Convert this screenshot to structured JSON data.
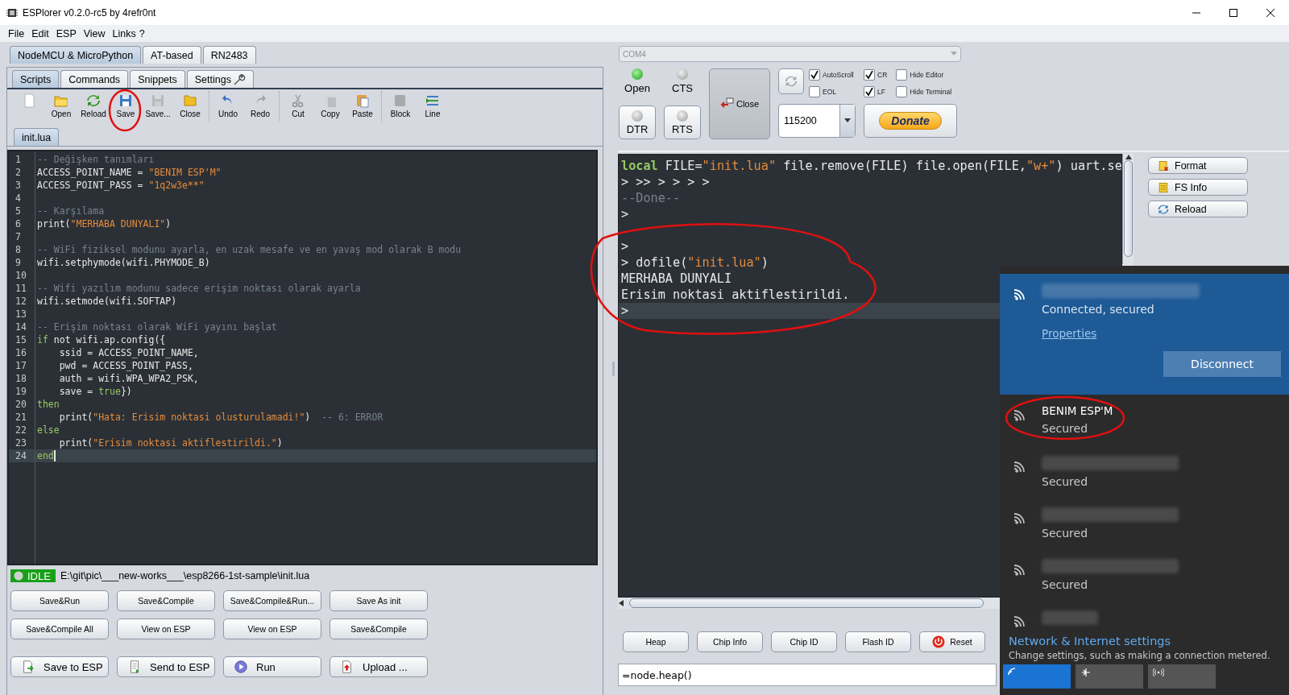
{
  "window": {
    "title": "ESPlorer v0.2.0-rc5 by 4refr0nt"
  },
  "menu": [
    "File",
    "Edit",
    "ESP",
    "View",
    "Links",
    "?"
  ],
  "device_tabs": [
    {
      "label": "NodeMCU & MicroPython",
      "selected": true
    },
    {
      "label": "AT-based",
      "selected": false
    },
    {
      "label": "RN2483",
      "selected": false
    }
  ],
  "editor_tabs": [
    {
      "label": "Scripts",
      "selected": true
    },
    {
      "label": "Commands",
      "selected": false
    },
    {
      "label": "Snippets",
      "selected": false
    },
    {
      "label": "Settings",
      "selected": false
    }
  ],
  "toolbar_groups": [
    {
      "items": [
        {
          "disabled": false
        },
        {
          "label": "Open",
          "disabled": false
        },
        {
          "label": "Reload",
          "disabled": false
        },
        {
          "label": "Save",
          "disabled": false
        },
        {
          "label": "Save...",
          "disabled": true
        },
        {
          "label": "Close",
          "disabled": false
        }
      ]
    },
    {
      "items": [
        {
          "label": "Undo",
          "disabled": false
        },
        {
          "label": "Redo",
          "disabled": true
        }
      ]
    },
    {
      "items": [
        {
          "label": "Cut",
          "disabled": true
        },
        {
          "label": "Copy",
          "disabled": true
        },
        {
          "label": "Paste",
          "disabled": false
        }
      ]
    },
    {
      "items": [
        {
          "label": "Block",
          "disabled": true
        },
        {
          "label": "Line",
          "disabled": false
        }
      ]
    }
  ],
  "file_tabs": [
    {
      "label": "init.lua",
      "selected": true
    }
  ],
  "code_lines": [
    {
      "number": "1",
      "current": false,
      "tokens": [
        {
          "kind": "comment",
          "text": "-- Değişken tanımları"
        }
      ]
    },
    {
      "number": "2",
      "current": false,
      "tokens": [
        {
          "kind": "plain",
          "text": "ACCESS_POINT_NAME = "
        },
        {
          "kind": "string",
          "text": "\"BENIM ESP'M\""
        }
      ]
    },
    {
      "number": "3",
      "current": false,
      "tokens": [
        {
          "kind": "plain",
          "text": "ACCESS_POINT_PASS = "
        },
        {
          "kind": "string",
          "text": "\"1q2w3e**\""
        }
      ]
    },
    {
      "number": "4",
      "current": false
    },
    {
      "number": "5",
      "current": false,
      "tokens": [
        {
          "kind": "comment",
          "text": "-- Karşılama"
        }
      ]
    },
    {
      "number": "6",
      "current": false,
      "tokens": [
        {
          "kind": "plain",
          "text": "print("
        },
        {
          "kind": "string",
          "text": "\"MERHABA DUNYALI\""
        },
        {
          "kind": "plain",
          "text": ")"
        }
      ]
    },
    {
      "number": "7",
      "current": false
    },
    {
      "number": "8",
      "current": false,
      "tokens": [
        {
          "kind": "comment",
          "text": "-- WiFi fiziksel modunu ayarla, en uzak mesafe ve en yavaş mod olarak B modu"
        }
      ]
    },
    {
      "number": "9",
      "current": false,
      "tokens": [
        {
          "kind": "plain",
          "text": "wifi.setphymode(wifi.PHYMODE_B)"
        }
      ]
    },
    {
      "number": "10",
      "current": false
    },
    {
      "number": "11",
      "current": false,
      "tokens": [
        {
          "kind": "comment",
          "text": "-- Wifi yazılım modunu sadece erişim noktası olarak ayarla"
        }
      ]
    },
    {
      "number": "12",
      "current": false,
      "tokens": [
        {
          "kind": "plain",
          "text": "wifi.setmode(wifi.SOFTAP)"
        }
      ]
    },
    {
      "number": "13",
      "current": false
    },
    {
      "number": "14",
      "current": false,
      "tokens": [
        {
          "kind": "comment",
          "text": "-- Erişim noktası olarak WiFi yayını başlat"
        }
      ]
    },
    {
      "number": "15",
      "current": false,
      "tokens": [
        {
          "kind": "keyword",
          "text": "if"
        },
        {
          "kind": "plain",
          "text": " not wifi.ap.config({"
        }
      ]
    },
    {
      "number": "16",
      "current": false,
      "tokens": [
        {
          "kind": "plain",
          "text": "    ssid = ACCESS_POINT_NAME,"
        }
      ]
    },
    {
      "number": "17",
      "current": false,
      "tokens": [
        {
          "kind": "plain",
          "text": "    pwd = ACCESS_POINT_PASS,"
        }
      ]
    },
    {
      "number": "18",
      "current": false,
      "tokens": [
        {
          "kind": "plain",
          "text": "    auth = wifi.WPA_WPA2_PSK,"
        }
      ]
    },
    {
      "number": "19",
      "current": false,
      "tokens": [
        {
          "kind": "plain",
          "text": "    save = "
        },
        {
          "kind": "keyword",
          "text": "true"
        },
        {
          "kind": "plain",
          "text": "})"
        }
      ]
    },
    {
      "number": "20",
      "current": false,
      "tokens": [
        {
          "kind": "keyword",
          "text": "then"
        }
      ]
    },
    {
      "number": "21",
      "current": false,
      "tokens": [
        {
          "kind": "plain",
          "text": "    print("
        },
        {
          "kind": "string",
          "text": "\"Hata: Erisim noktasi olusturulamadi!\""
        },
        {
          "kind": "plain",
          "text": ")  "
        },
        {
          "kind": "comment",
          "text": "-- 6: ERROR"
        }
      ]
    },
    {
      "number": "22",
      "current": false,
      "tokens": [
        {
          "kind": "keyword",
          "text": "else"
        }
      ]
    },
    {
      "number": "23",
      "current": false,
      "tokens": [
        {
          "kind": "plain",
          "text": "    print("
        },
        {
          "kind": "string",
          "text": "\"Erisim noktasi aktiflestirildi.\""
        },
        {
          "kind": "plain",
          "text": ")"
        }
      ]
    },
    {
      "number": "24",
      "current": true,
      "tokens": [
        {
          "kind": "keyword",
          "text": "end"
        }
      ]
    }
  ],
  "status": {
    "state": "IDLE",
    "path": "E:\\git\\pic\\___new-works___\\esp8266-1st-sample\\init.lua"
  },
  "script_button_rows": [
    {
      "buttons": [
        "Save&Run",
        "Save&Compile",
        "Save&Compile&Run...",
        "Save As init"
      ]
    },
    {
      "buttons": [
        "Save&Compile All",
        "View on ESP",
        "View on ESP",
        "Save&Compile"
      ]
    },
    {
      "buttons": [
        "Save to ESP",
        "Send to ESP",
        "Run",
        "Upload ..."
      ]
    }
  ],
  "port": {
    "value": "COM4",
    "disabled": true
  },
  "indicators": [
    {
      "label": "Open",
      "on": true
    },
    {
      "label": "CTS",
      "on": false
    }
  ],
  "line_buttons": [
    {
      "label": "DTR",
      "on": false
    },
    {
      "label": "RTS",
      "on": false
    }
  ],
  "close_button": "Close",
  "baud": "115200",
  "checkboxes": [
    {
      "label": "AutoScroll",
      "checked": true
    },
    {
      "label": "EOL",
      "checked": false
    },
    {
      "label": "CR",
      "checked": true
    },
    {
      "label": "LF",
      "checked": true
    },
    {
      "label": "Hide Editor",
      "checked": false
    },
    {
      "label": "Hide Terminal",
      "checked": false
    }
  ],
  "donate_button": "Donate",
  "terminal_lines": [
    {
      "current": false,
      "tokens": [
        {
          "kind": "keyword",
          "text": "local"
        },
        {
          "kind": "plain",
          "text": " FILE="
        },
        {
          "kind": "string",
          "text": "\"init.lua\""
        },
        {
          "kind": "plain",
          "text": " file.remove(FILE) file.open(FILE,"
        },
        {
          "kind": "string",
          "text": "\"w+\""
        },
        {
          "kind": "plain",
          "text": ") uart.se"
        }
      ]
    },
    {
      "current": false,
      "tokens": [
        {
          "kind": "plain",
          "text": "> >> > > > >"
        }
      ]
    },
    {
      "current": false,
      "tokens": [
        {
          "kind": "comment",
          "text": "--Done--"
        }
      ]
    },
    {
      "current": false,
      "tokens": [
        {
          "kind": "plain",
          "text": ">"
        }
      ]
    },
    {
      "current": false
    },
    {
      "current": false,
      "tokens": [
        {
          "kind": "plain",
          "text": ">"
        }
      ]
    },
    {
      "current": false,
      "tokens": [
        {
          "kind": "plain",
          "text": "> dofile("
        },
        {
          "kind": "string",
          "text": "\"init.lua\""
        },
        {
          "kind": "plain",
          "text": ")"
        }
      ]
    },
    {
      "current": false,
      "tokens": [
        {
          "kind": "plain",
          "text": "MERHABA DUNYALI"
        }
      ]
    },
    {
      "current": false,
      "tokens": [
        {
          "kind": "plain",
          "text": "Erisim noktasi aktiflestirildi."
        }
      ]
    },
    {
      "current": true,
      "tokens": [
        {
          "kind": "plain",
          "text": ">"
        }
      ]
    }
  ],
  "fs_buttons": [
    "Format",
    "FS Info",
    "Reload"
  ],
  "command_buttons": [
    "Heap",
    "Chip Info",
    "Chip ID",
    "Flash ID",
    "Reset"
  ],
  "command_input": {
    "value": "=node.heap()"
  },
  "wifi_flyout": {
    "networks": [
      {
        "connected": true,
        "redacted": true,
        "status": "Connected, secured",
        "link": "Properties",
        "button": "Disconnect"
      },
      {
        "connected": false,
        "redacted": false,
        "name": "BENIM ESP'M",
        "status": "Secured"
      },
      {
        "connected": false,
        "redacted": true,
        "status": "Secured"
      },
      {
        "connected": false,
        "redacted": true,
        "status": "Secured"
      },
      {
        "connected": false,
        "redacted": true,
        "status": "Secured"
      },
      {
        "connected": false,
        "redacted": true
      }
    ],
    "settings_link": "Network & Internet settings",
    "settings_hint": "Change settings, such as making a connection metered.",
    "quick_tiles": [
      {
        "on": true
      },
      {
        "on": false
      },
      {
        "on": false
      }
    ]
  }
}
